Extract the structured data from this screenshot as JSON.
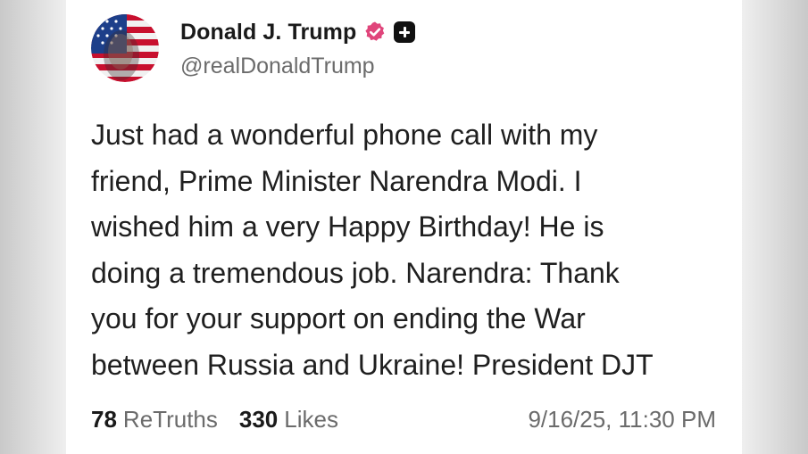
{
  "post": {
    "author": {
      "display_name": "Donald J. Trump",
      "handle": "@realDonaldTrump",
      "verified_icon": "verified-badge-icon",
      "plus_icon": "plus-icon"
    },
    "text": "Just had a wonderful phone call with my\nfriend, Prime Minister Narendra Modi. I\nwished him a very Happy Birthday! He is\ndoing a tremendous job. Narendra: Thank\nyou for your support on ending the War\nbetween Russia and Ukraine! President DJT",
    "stats": {
      "retruths_count": "78",
      "retruths_label": "ReTruths",
      "likes_count": "330",
      "likes_label": "Likes"
    },
    "timestamp": "9/16/25, 11:30 PM"
  },
  "colors": {
    "verified": "#e0457b",
    "text_primary": "#1a1a1a",
    "text_secondary": "#6b6b6b",
    "background": "#ffffff"
  }
}
